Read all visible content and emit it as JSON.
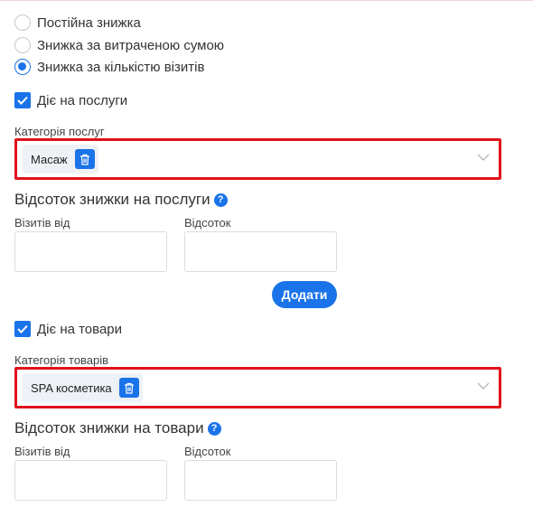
{
  "discount_type": {
    "options": [
      {
        "label": "Постійна знижка",
        "selected": false
      },
      {
        "label": "Знижка за витраченою сумою",
        "selected": false
      },
      {
        "label": "Знижка за кількістю візитів",
        "selected": true
      }
    ]
  },
  "services": {
    "applies_label": "Діє на послуги",
    "applies_checked": true,
    "category_label": "Категорія послуг",
    "selected_categories": [
      "Масаж"
    ],
    "percent_title": "Відсоток знижки на послуги",
    "visits_from_label": "Візитів від",
    "percent_label": "Відсоток",
    "visits_from_value": "",
    "percent_value": "",
    "add_label": "Додати"
  },
  "products": {
    "applies_label": "Діє на товари",
    "applies_checked": true,
    "category_label": "Категорія товарів",
    "selected_categories": [
      "SPA косметика"
    ],
    "percent_title": "Відсоток знижки на товари",
    "visits_from_label": "Візитів від",
    "percent_label": "Відсоток",
    "visits_from_value": "",
    "percent_value": ""
  },
  "icons": {
    "help": "?",
    "chip_delete": "trash-icon",
    "dropdown": "chevron-down-icon",
    "checkbox": "check-icon"
  },
  "colors": {
    "accent": "#1a73e8",
    "highlight_border": "#e0121b",
    "chip_bg": "#eef1f5"
  }
}
